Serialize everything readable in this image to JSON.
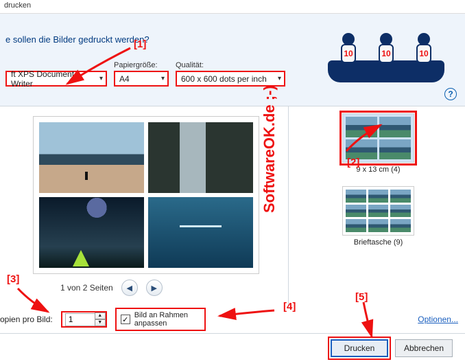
{
  "title_bar": "drucken",
  "question": "e sollen die Bilder gedruckt werden?",
  "labels": {
    "paper_size": "Papiergröße:",
    "quality": "Qualität:"
  },
  "dropdowns": {
    "printer": "ft XPS Document Writer",
    "paper_size": "A4",
    "quality": "600 x 600 dots per inch"
  },
  "owls": {
    "n1": "10",
    "n2": "10",
    "n3": "10"
  },
  "pager": "1 von 2 Seiten",
  "layouts": {
    "sel_label": "9 x 13 cm (4)",
    "wallet_label": "Brieftasche (9)"
  },
  "copies": {
    "label": "opien pro Bild:",
    "value": "1"
  },
  "fit_frame_label": "Bild an Rahmen\nanpassen",
  "options_link": "Optionen...",
  "buttons": {
    "print": "Drucken",
    "cancel": "Abbrechen"
  },
  "annotations": {
    "n1": "[1]",
    "n2": "[2]",
    "n3": "[3]",
    "n4": "[4]",
    "n5": "[5]"
  },
  "watermark": "SoftwareOK.de ;-)"
}
